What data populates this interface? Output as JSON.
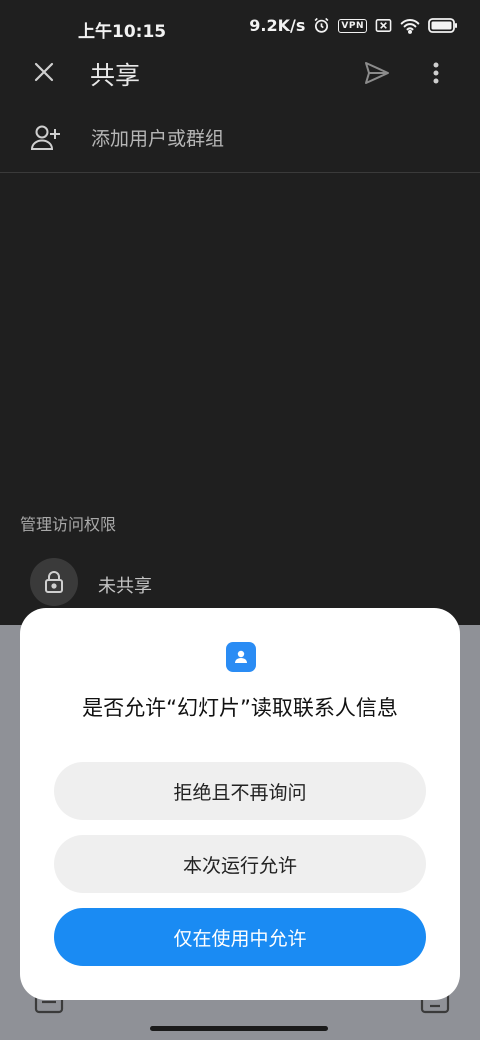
{
  "status_bar": {
    "time": "上午10:15",
    "network_speed": "9.2K/s",
    "vpn_label": "VPN",
    "icons": [
      "alarm-icon",
      "vpn-icon",
      "sim-none-icon",
      "wifi-icon",
      "battery-icon"
    ]
  },
  "app_bar": {
    "title": "共享",
    "icons": [
      "close-icon",
      "send-icon",
      "more-vert-icon"
    ]
  },
  "add_people": {
    "placeholder": "添加用户或群组",
    "icon": "person-add-icon"
  },
  "access": {
    "section_label": "管理访问权限",
    "status": "未共享",
    "icon": "lock-icon"
  },
  "dialog": {
    "icon": "contacts-icon",
    "title": "是否允许“幻灯片”读取联系人信息",
    "buttons": {
      "deny": "拒绝且不再询问",
      "allow_once": "本次运行允许",
      "allow_while_using": "仅在使用中允许"
    },
    "accent_color": "#1a8bf3"
  }
}
